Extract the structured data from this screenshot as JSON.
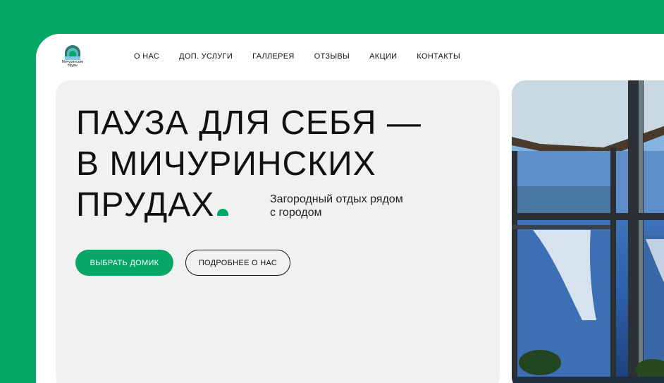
{
  "logo": {
    "text": "Мичуринские пруды"
  },
  "nav": {
    "items": [
      {
        "label": "О НАС"
      },
      {
        "label": "ДОП. УСЛУГИ"
      },
      {
        "label": "ГАЛЛЕРЕЯ"
      },
      {
        "label": "ОТЗЫВЫ"
      },
      {
        "label": "АКЦИИ"
      },
      {
        "label": "КОНТАКТЫ"
      }
    ]
  },
  "hero": {
    "headline_lines": [
      "ПАУЗА ДЛЯ СЕБЯ —",
      "В МИЧУРИНСКИХ",
      "ПРУДАХ"
    ],
    "subtitle": "Загородный отдых рядом с городом",
    "primary_button": "ВЫБРАТЬ ДОМИК",
    "secondary_button": "ПОДРОБНЕЕ О НАС"
  },
  "colors": {
    "accent": "#04a766",
    "background": "#ffffff",
    "panel": "#f1f1f1"
  }
}
